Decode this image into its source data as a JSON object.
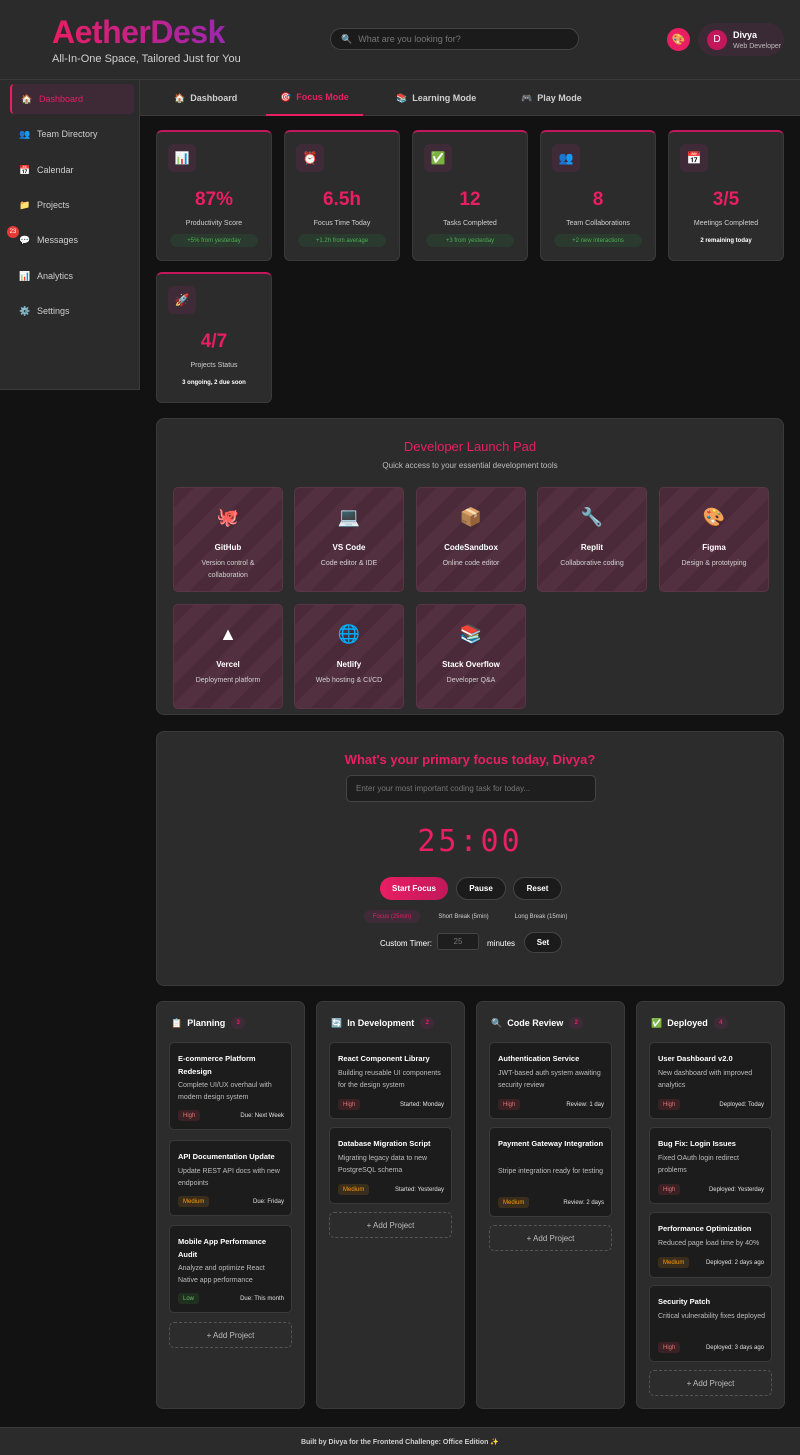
{
  "header": {
    "logo": "AetherDesk",
    "tagline": "All-In-One Space, Tailored Just for You",
    "search_placeholder": "What are you looking for?",
    "search_icon": "🔍",
    "theme_icon": "🎨",
    "user_initial": "D",
    "user_name": "Divya",
    "user_role": "Web Developer"
  },
  "sidebar": {
    "items": [
      {
        "icon": "🏠",
        "label": "Dashboard"
      },
      {
        "icon": "👥",
        "label": "Team Directory"
      },
      {
        "icon": "📅",
        "label": "Calendar"
      },
      {
        "icon": "📁",
        "label": "Projects"
      },
      {
        "icon": "💬",
        "label": "Messages",
        "badge": "23"
      },
      {
        "icon": "📊",
        "label": "Analytics"
      },
      {
        "icon": "⚙️",
        "label": "Settings"
      }
    ]
  },
  "tabs": [
    {
      "icon": "🏠",
      "label": "Dashboard"
    },
    {
      "icon": "🎯",
      "label": "Focus Mode"
    },
    {
      "icon": "📚",
      "label": "Learning Mode"
    },
    {
      "icon": "🎮",
      "label": "Play Mode"
    }
  ],
  "stats": [
    {
      "icon": "📊",
      "value": "87%",
      "label": "Productivity Score",
      "change": "+5% from yesterday"
    },
    {
      "icon": "⏰",
      "value": "6.5h",
      "label": "Focus Time Today",
      "change": "+1.2h from average"
    },
    {
      "icon": "✅",
      "value": "12",
      "label": "Tasks Completed",
      "change": "+3 from yesterday"
    },
    {
      "icon": "👥",
      "value": "8",
      "label": "Team Collaborations",
      "change": "+2 new interactions"
    },
    {
      "icon": "📅",
      "value": "3/5",
      "label": "Meetings Completed",
      "change": "2 remaining today"
    },
    {
      "icon": "🚀",
      "value": "4/7",
      "label": "Projects Status",
      "change": "3 ongoing, 2 due soon"
    }
  ],
  "launchpad": {
    "title": "Developer Launch Pad",
    "subtitle": "Quick access to your essential development tools",
    "tools": [
      {
        "icon": "🐙",
        "name": "GitHub",
        "desc": "Version control & collaboration"
      },
      {
        "icon": "💻",
        "name": "VS Code",
        "desc": "Code editor & IDE"
      },
      {
        "icon": "📦",
        "name": "CodeSandbox",
        "desc": "Online code editor"
      },
      {
        "icon": "🔧",
        "name": "Replit",
        "desc": "Collaborative coding"
      },
      {
        "icon": "🎨",
        "name": "Figma",
        "desc": "Design & prototyping"
      },
      {
        "icon": "▲",
        "name": "Vercel",
        "desc": "Deployment platform"
      },
      {
        "icon": "🌐",
        "name": "Netlify",
        "desc": "Web hosting & CI/CD"
      },
      {
        "icon": "📚",
        "name": "Stack Overflow",
        "desc": "Developer Q&A"
      }
    ]
  },
  "focus": {
    "title": "What's your primary focus today, Divya?",
    "input_placeholder": "Enter your most important coding task for today...",
    "timer": "25:00",
    "start_label": "Start Focus",
    "pause_label": "Pause",
    "reset_label": "Reset",
    "modes": [
      "Focus (25min)",
      "Short Break (5min)",
      "Long Break (15min)"
    ],
    "custom_label": "Custom Timer:",
    "custom_placeholder": "25",
    "minutes_label": "minutes",
    "set_label": "Set"
  },
  "kanban": [
    {
      "icon": "📋",
      "title": "Planning",
      "count": "3",
      "cards": [
        {
          "title": "E-commerce Platform Redesign",
          "desc": "Complete UI/UX overhaul with modern design system",
          "priority": "High",
          "due": "Due: Next Week"
        },
        {
          "title": "API Documentation Update",
          "desc": "Update REST API docs with new endpoints",
          "priority": "Medium",
          "due": "Due: Friday"
        },
        {
          "title": "Mobile App Performance Audit",
          "desc": "Analyze and optimize React Native app performance",
          "priority": "Low",
          "due": "Due: This month"
        }
      ]
    },
    {
      "icon": "🔄",
      "title": "In Development",
      "count": "2",
      "cards": [
        {
          "title": "React Component Library",
          "desc": "Building reusable UI components for the design system",
          "priority": "High",
          "due": "Started: Monday"
        },
        {
          "title": "Database Migration Script",
          "desc": "Migrating legacy data to new PostgreSQL schema",
          "priority": "Medium",
          "due": "Started: Yesterday"
        }
      ]
    },
    {
      "icon": "🔍",
      "title": "Code Review",
      "count": "2",
      "cards": [
        {
          "title": "Authentication Service",
          "desc": "JWT-based auth system awaiting security review",
          "priority": "High",
          "due": "Review: 1 day"
        },
        {
          "title": "Payment Gateway Integration",
          "desc": "Stripe integration ready for testing",
          "priority": "Medium",
          "due": "Review: 2 days"
        }
      ]
    },
    {
      "icon": "✅",
      "title": "Deployed",
      "count": "4",
      "cards": [
        {
          "title": "User Dashboard v2.0",
          "desc": "New dashboard with improved analytics",
          "priority": "High",
          "due": "Deployed: Today"
        },
        {
          "title": "Bug Fix: Login Issues",
          "desc": "Fixed OAuth login redirect problems",
          "priority": "High",
          "due": "Deployed: Yesterday"
        },
        {
          "title": "Performance Optimization",
          "desc": "Reduced page load time by 40%",
          "priority": "Medium",
          "due": "Deployed: 2 days ago"
        },
        {
          "title": "Security Patch",
          "desc": "Critical vulnerability fixes deployed",
          "priority": "High",
          "due": "Deployed: 3 days ago"
        }
      ]
    }
  ],
  "add_project_label": "+ Add Project",
  "footer": "Built by Divya for the Frontend Challenge: Office Edition ✨"
}
